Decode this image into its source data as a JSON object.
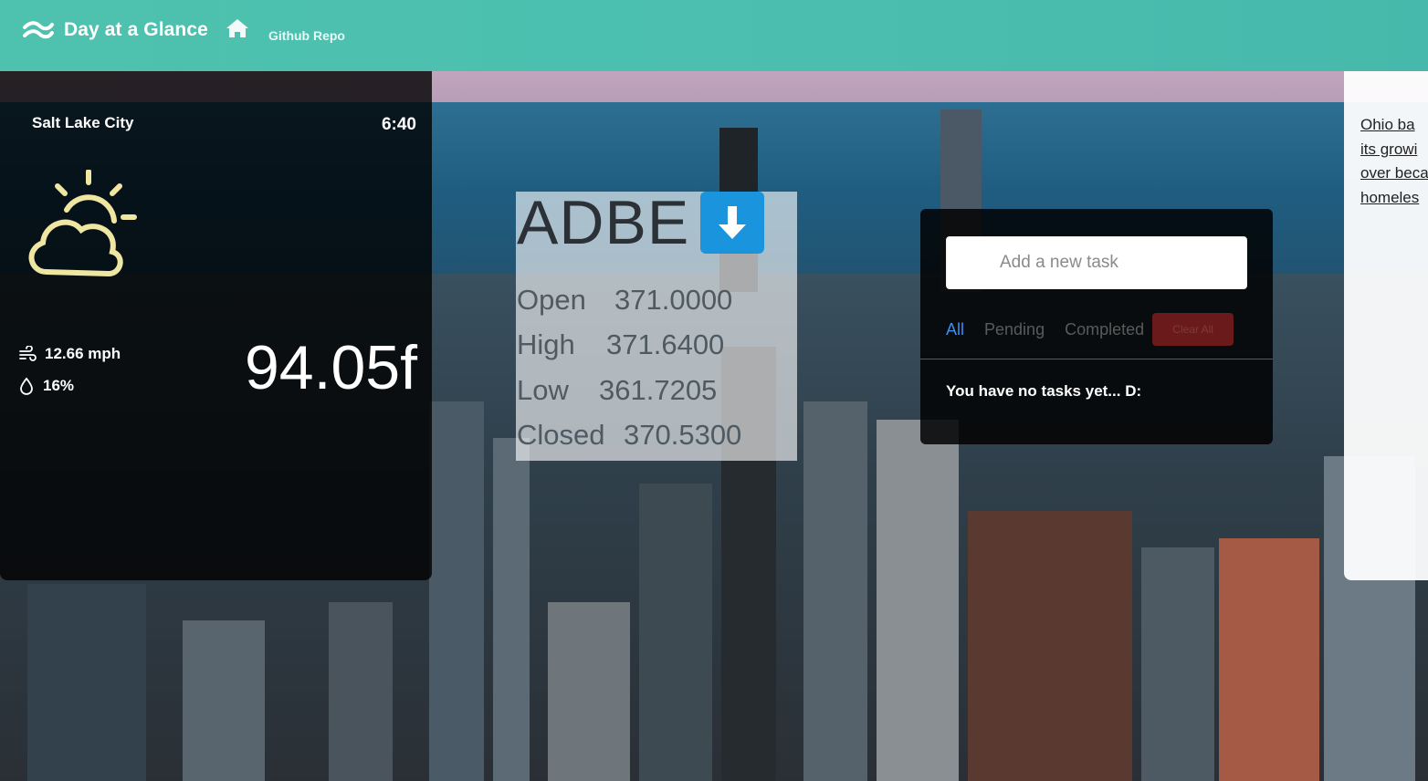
{
  "nav": {
    "brand": "Day at a Glance",
    "home_icon": "home-icon",
    "repo_link": "Github Repo"
  },
  "weather": {
    "city": "Salt Lake City",
    "time": "6:40",
    "condition_icon": "partly-cloudy-icon",
    "wind": "12.66 mph",
    "humidity": "16%",
    "temperature": "94.05f"
  },
  "stock": {
    "ticker": "ADBE",
    "trend_icon": "arrow-down-icon",
    "stats": [
      {
        "label": "Open",
        "value": "371.0000"
      },
      {
        "label": "High",
        "value": "371.6400"
      },
      {
        "label": "Low",
        "value": "361.7205"
      },
      {
        "label": "Closed",
        "value": "370.5300"
      }
    ]
  },
  "todo": {
    "input_placeholder": "Add a new task",
    "filters": {
      "all": "All",
      "pending": "Pending",
      "completed": "Completed"
    },
    "clear_label": "Clear All",
    "empty_message": "You have no tasks yet... D:"
  },
  "news": {
    "headline_lines": [
      "Ohio ba",
      "its growi",
      "over beca",
      "homeles"
    ]
  },
  "colors": {
    "nav_bg": "#4ec2ae",
    "accent_blue": "#1a95dd",
    "filter_active": "#3a8ef0",
    "clear_button": "#6a1a1a",
    "weather_icon": "#efe6a2"
  }
}
